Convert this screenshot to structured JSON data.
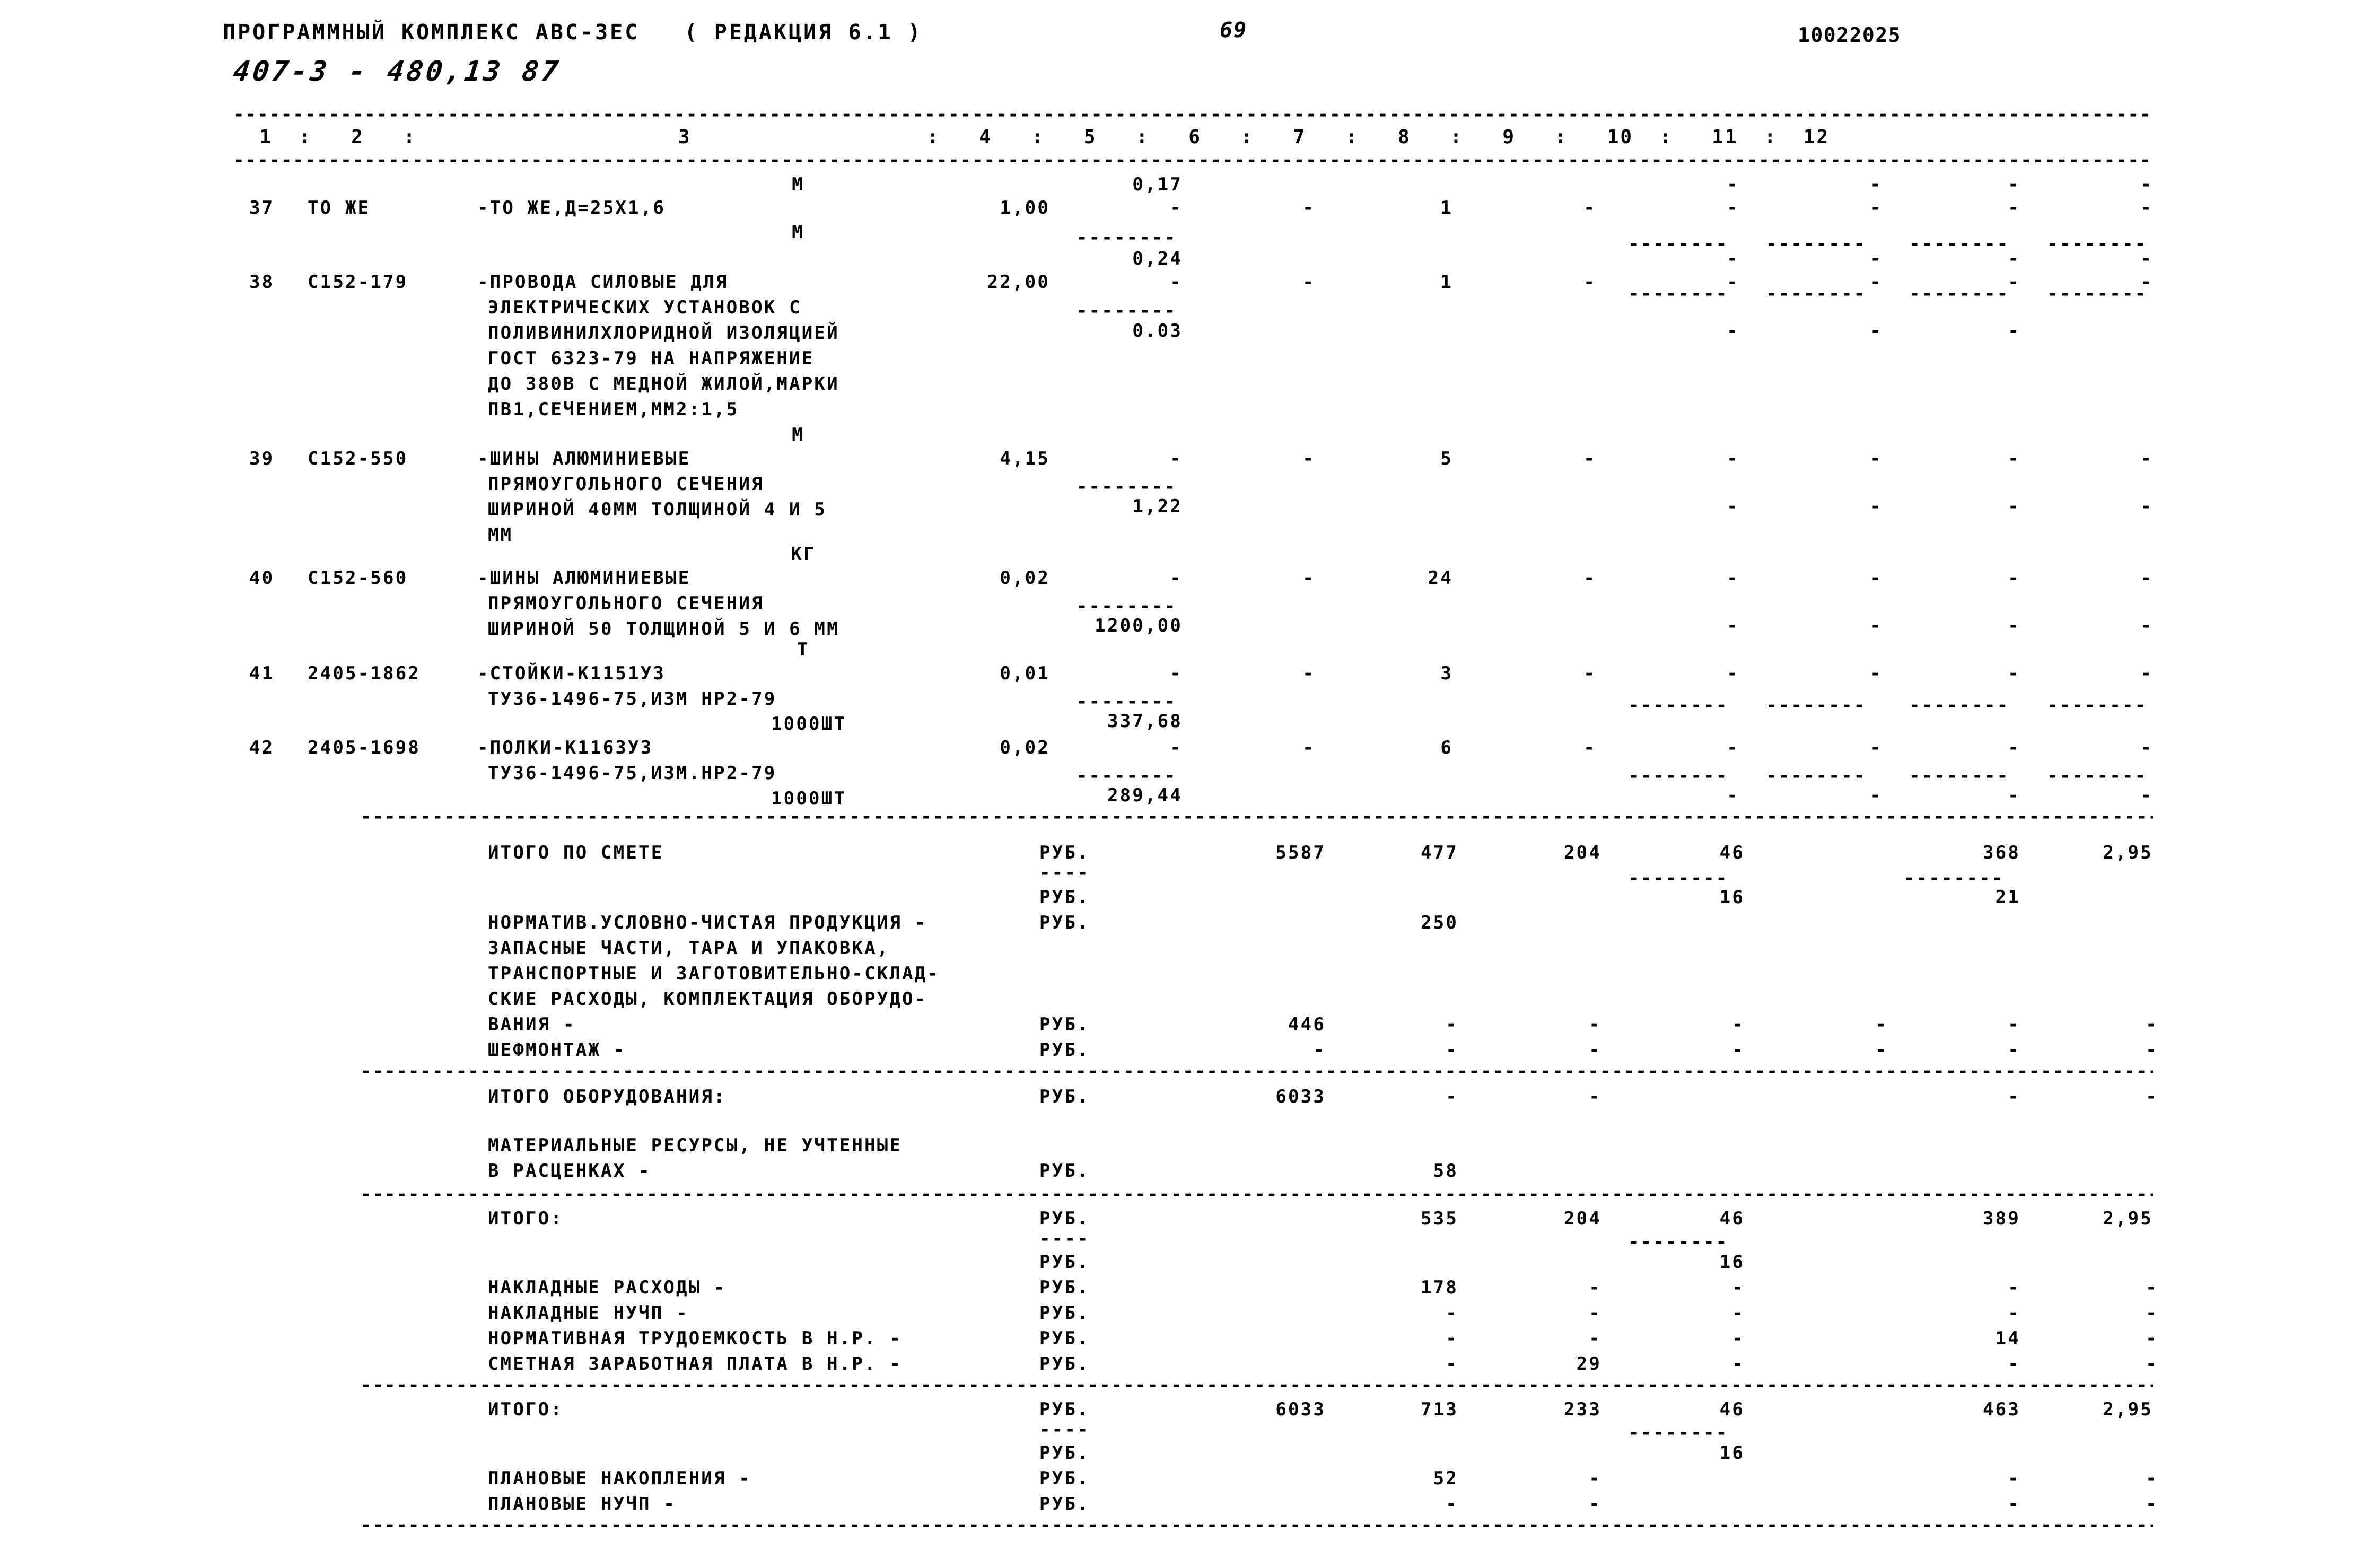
{
  "header": {
    "title": "ПРОГРАММНЫЙ КОМПЛЕКС АВС-ЗЕС   ( РЕДАКЦИЯ 6.1 )",
    "page_number": "69",
    "document_code": "10022025",
    "handwritten_ref": "407-3 - 480,13 87"
  },
  "table": {
    "column_numbers": [
      "1",
      "2",
      "3",
      "4",
      "5",
      "6",
      "7",
      "8",
      "9",
      "10",
      "11",
      "12"
    ],
    "column_header_line": "  1  :   2   :                    3                  :   4   :   5   :   6   :   7   :   8   :   9   :   10  :   11  :  12",
    "rule_char": "-",
    "dash_placeholder": "-"
  },
  "items": [
    {
      "no": "37",
      "code": "ТО ЖЕ",
      "desc_lines": [
        "-ТО ЖЕ,Д=25Х1,6"
      ],
      "unit": "М",
      "qty": "1,00",
      "col5_top": "0,17",
      "col5": "-",
      "col6": "-",
      "col7": "1",
      "col8": "-",
      "col9": "-",
      "col10": "-",
      "col11": "-",
      "col12": "-"
    },
    {
      "no": "38",
      "code": "С152-179",
      "desc_lines": [
        "-ПРОВОДА СИЛОВЫЕ ДЛЯ",
        "ЭЛЕКТРИЧЕСКИХ УСТАНОВОК С",
        "ПОЛИВИНИЛХЛОРИДНОЙ ИЗОЛЯЦИЕЙ",
        "ГОСТ 6323-79 НА НАПРЯЖЕНИЕ",
        "ДО 380В С МЕДНОЙ ЖИЛОЙ,МАРКИ",
        "ПВ1,СЕЧЕНИЕМ,ММ2:1,5"
      ],
      "unit": "М",
      "qty": "22,00",
      "col5_top": "0,24",
      "col5": "-",
      "col5_under": "0.03",
      "col6": "-",
      "col7": "1",
      "col8": "-",
      "col9": "-",
      "col10": "-",
      "col11": "-",
      "col12": "-"
    },
    {
      "no": "39",
      "code": "С152-550",
      "desc_lines": [
        "-ШИНЫ АЛЮМИНИЕВЫЕ",
        "ПРЯМОУГОЛЬНОГО СЕЧЕНИЯ",
        "ШИРИНОЙ 40ММ ТОЛЩИНОЙ 4 И 5",
        "ММ"
      ],
      "unit": "М",
      "qty": "4,15",
      "col5_top": "-",
      "col5_under": "1,22",
      "col6": "-",
      "col7": "5",
      "col8": "-",
      "col9": "-",
      "col10": "-",
      "col11": "-",
      "col12": "-"
    },
    {
      "no": "40",
      "code": "С152-560",
      "desc_lines": [
        "-ШИНЫ АЛЮМИНИЕВЫЕ",
        "ПРЯМОУГОЛЬНОГО СЕЧЕНИЯ",
        "ШИРИНОЙ 50 ТОЛЩИНОЙ 5 И 6 ММ"
      ],
      "unit": "КГ",
      "qty": "0,02",
      "col5_top": "-",
      "col5_under": "1200,00",
      "col6": "-",
      "col7": "24",
      "col8": "-",
      "col9": "-",
      "col10": "-",
      "col11": "-",
      "col12": "-"
    },
    {
      "no": "41",
      "code": "2405-1862",
      "desc_lines": [
        "-СТОЙКИ-К1151У3",
        "ТУ36-1496-75,ИЗМ НР2-79"
      ],
      "unit": "Т",
      "unit2": "1000ШТ",
      "qty": "0,01",
      "col5_top": "-",
      "col5_under": "337,68",
      "col6": "-",
      "col7": "3",
      "col8": "-",
      "col9": "-",
      "col10": "-",
      "col11": "-",
      "col12": "-"
    },
    {
      "no": "42",
      "code": "2405-1698",
      "desc_lines": [
        "-ПОЛКИ-К1163У3",
        "ТУ36-1496-75,ИЗМ.НР2-79"
      ],
      "unit": "1000ШТ",
      "qty": "0,02",
      "col5_top": "-",
      "col5_under": "289,44",
      "col6": "-",
      "col7": "6",
      "col8": "-",
      "col9": "-",
      "col10": "-",
      "col11": "-",
      "col12": "-"
    }
  ],
  "summary": {
    "itogo_po_smete": {
      "label": "ИТОГО ПО СМЕТЕ",
      "unit": "РУБ.",
      "col6": "5587",
      "col7": "477",
      "col8": "204",
      "col9": "46",
      "col11": "368",
      "col12": "2,95"
    },
    "itogo_po_smete_second": {
      "unit": "РУБ.",
      "col9": "16",
      "col11": "21"
    },
    "nuchp": {
      "label_lines": [
        "НОРМАТИВ.УСЛОВНО-ЧИСТАЯ ПРОДУКЦИЯ -",
        "ЗАПАСНЫЕ ЧАСТИ, ТАРА И УПАКОВКА,",
        "ТРАНСПОРТНЫЕ И ЗАГОТОВИТЕЛЬНО-СКЛАД-",
        "СКИЕ РАСХОДЫ, КОМПЛЕКТАЦИЯ ОБОРУДО-",
        "ВАНИЯ -"
      ],
      "unit": "РУБ.",
      "col7": "250"
    },
    "vaniya": {
      "label": "ВАНИЯ -",
      "unit": "РУБ.",
      "col6": "446",
      "col7": "-",
      "col8": "-",
      "col9": "-",
      "col10": "-",
      "col11": "-",
      "col12": "-"
    },
    "shefmontazh": {
      "label": "ШЕФМОНТАЖ -",
      "unit": "РУБ.",
      "col6": "-",
      "col7": "-",
      "col8": "-",
      "col9": "-",
      "col10": "-",
      "col11": "-",
      "col12": "-"
    },
    "itogo_oborudovaniya": {
      "label": "ИТОГО ОБОРУДОВАНИЯ:",
      "unit": "РУБ.",
      "col6": "6033",
      "col7": "-",
      "col8": "-",
      "col11": "-",
      "col12": "-"
    },
    "mat_resursy": {
      "label_lines": [
        "МАТЕРИАЛЬНЫЕ РЕСУРСЫ, НЕ УЧТЕННЫЕ",
        "В РАСЦЕНКАХ -"
      ],
      "unit": "РУБ.",
      "col7": "58"
    },
    "itogo_1": {
      "label": "ИТОГО:",
      "unit": "РУБ.",
      "col7": "535",
      "col8": "204",
      "col9": "46",
      "col11": "389",
      "col12": "2,95"
    },
    "itogo_1_second": {
      "unit": "РУБ.",
      "col9": "16"
    },
    "nakladnye_raskhody": {
      "label": "НАКЛАДНЫЕ РАСХОДЫ -",
      "unit": "РУБ.",
      "col7": "178",
      "col8": "-",
      "col9": "-",
      "col11": "-",
      "col12": "-"
    },
    "nakladnye_nuchp": {
      "label": "НАКЛАДНЫЕ НУЧП -",
      "unit": "РУБ.",
      "col7": "-",
      "col8": "-",
      "col9": "-",
      "col11": "-",
      "col12": "-"
    },
    "normativnaya_trudoemkost": {
      "label": "НОРМАТИВНАЯ ТРУДОЕМКОСТЬ В Н.Р. -",
      "unit": "РУБ.",
      "col7": "-",
      "col8": "-",
      "col9": "-",
      "col11": "14",
      "col12": "-"
    },
    "smetnaya_zarplata": {
      "label": "СМЕТНАЯ ЗАРАБОТНАЯ ПЛАТА В Н.Р. -",
      "unit": "РУБ.",
      "col7": "-",
      "col8": "29",
      "col9": "-",
      "col11": "-",
      "col12": "-"
    },
    "itogo_2": {
      "label": "ИТОГО:",
      "unit": "РУБ.",
      "col6": "6033",
      "col7": "713",
      "col8": "233",
      "col9": "46",
      "col11": "463",
      "col12": "2,95"
    },
    "itogo_2_second": {
      "unit": "РУБ.",
      "col9": "16"
    },
    "planovye_nakopleniya": {
      "label": "ПЛАНОВЫЕ НАКОПЛЕНИЯ -",
      "unit": "РУБ.",
      "col7": "52",
      "col8": "-",
      "col11": "-",
      "col12": "-"
    },
    "planovye_nuchp": {
      "label": "ПЛАНОВЫЕ НУЧП -",
      "unit": "РУБ.",
      "col7": "-",
      "col8": "-",
      "col11": "-",
      "col12": "-"
    }
  },
  "rules": {
    "long_dash": "--------------------------------------------------------------------------------------------------------------------------------------------------------------------------",
    "mid_dash": "------------------------------------------------------------------------------------------------------------------------",
    "short_dash": "-------",
    "tiny_dash": "----",
    "col_dash": "--------"
  }
}
